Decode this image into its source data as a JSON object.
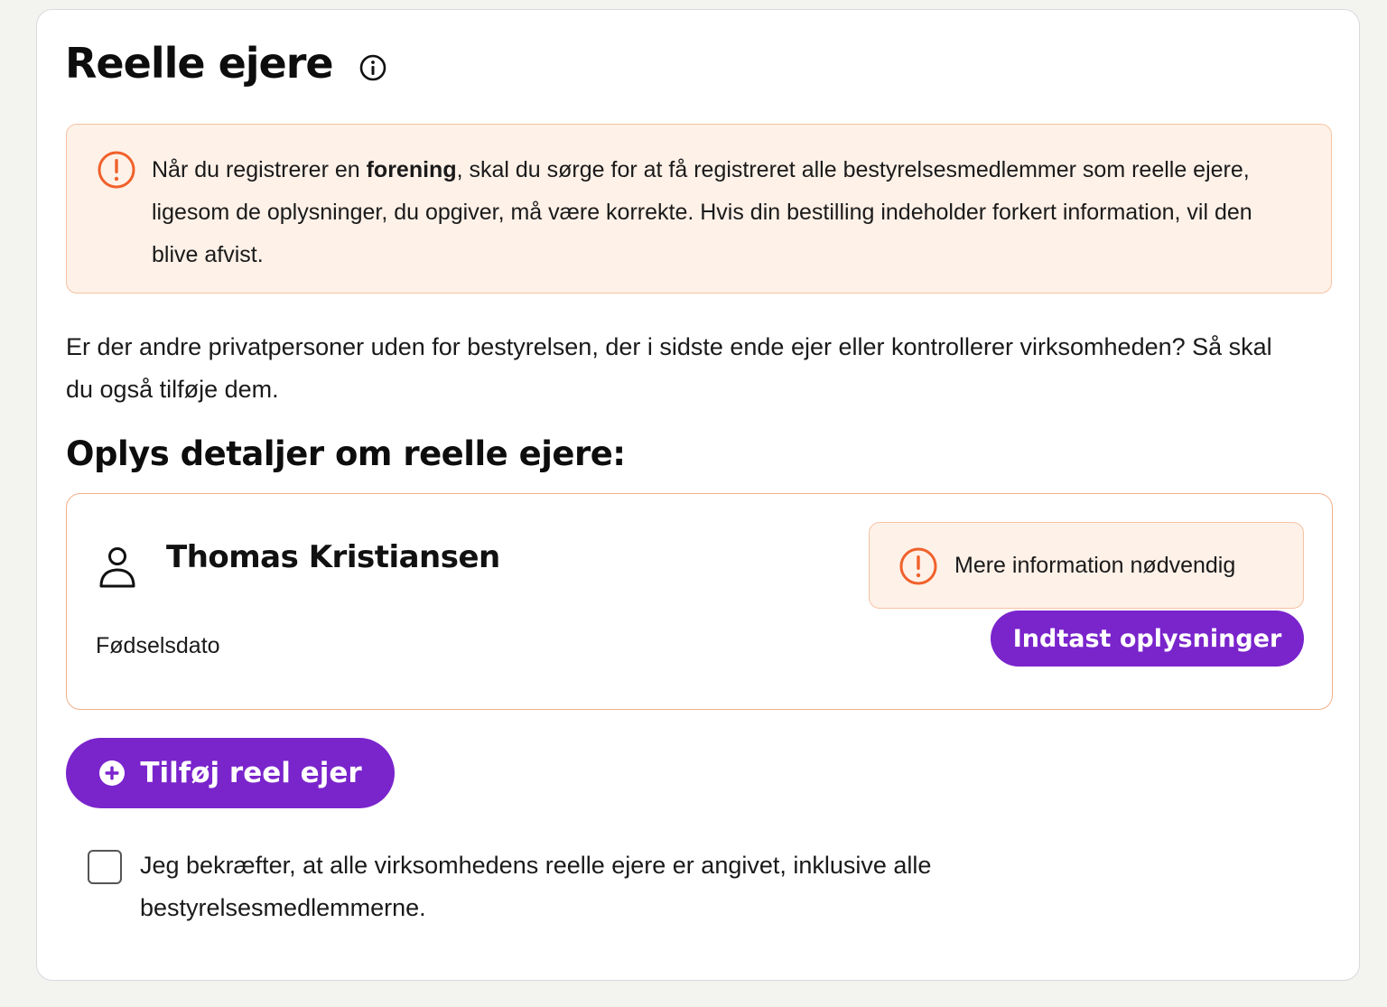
{
  "header": {
    "title": "Reelle ejere",
    "info_icon": "info-circle-icon"
  },
  "warning": {
    "icon": "exclamation-circle-icon",
    "icon_color": "#f0612b",
    "text_before": "Når du registrerer en ",
    "text_bold": "forening",
    "text_after": ", skal du sørge for at få registreret alle bestyrelsesmedlemmer som reelle ejere, ligesom de oplysninger, du opgiver, må være korrekte. Hvis din bestilling indeholder forkert information, vil den blive afvist."
  },
  "intro_text": "Er der andre privatpersoner uden for bestyrelsen, der i sidste ende ejer eller kontrollerer virksomheden? Så skal du også tilføje dem.",
  "section_title": "Oplys detaljer om reelle ejere:",
  "owner": {
    "icon": "person-icon",
    "name": "Thomas Kristiansen",
    "dob_label": "Fødselsdato",
    "status_text": "Mere information nødvendig",
    "status_icon": "exclamation-circle-icon",
    "enter_button_label": "Indtast oplysninger"
  },
  "add_button": {
    "icon": "plus-circle-icon",
    "label": "Tilføj reel ejer"
  },
  "confirm": {
    "checked": false,
    "text": "Jeg bekræfter, at alle virksomhedens reelle ejere er angivet, inklusive alle bestyrelsesmedlemmerne."
  },
  "colors": {
    "accent": "#7a24cc",
    "warning_bg": "#fef1e8",
    "warning_border": "#f6c3a3",
    "warning_icon": "#f0612b"
  }
}
